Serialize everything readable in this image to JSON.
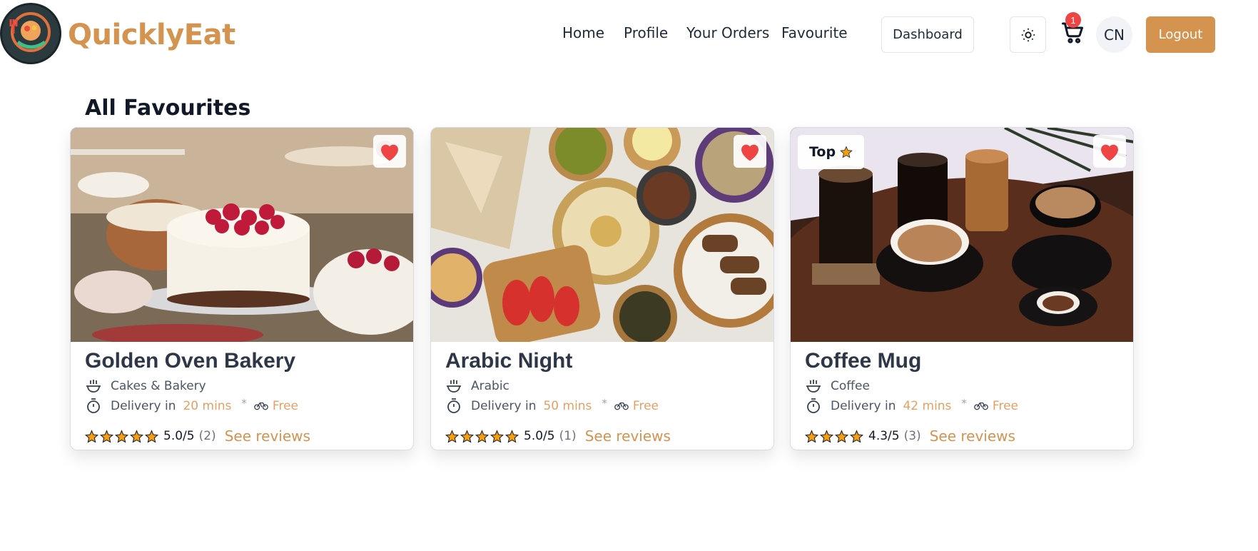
{
  "brand": {
    "name": "QuicklyEat"
  },
  "nav": {
    "home": "Home",
    "profile": "Profile",
    "orders": "Your Orders",
    "favourite": "Favourite",
    "dashboard": "Dashboard",
    "cart_count": "1",
    "avatar_initials": "CN",
    "logout": "Logout",
    "theme_icon": "sun-icon",
    "cart_icon": "cart-icon"
  },
  "page": {
    "title": "All Favourites"
  },
  "colors": {
    "accent": "#d4934e",
    "heart": "#ef4444",
    "star": "#f59e0b"
  },
  "cards": [
    {
      "name": "Golden Oven Bakery",
      "category": "Cakes & Bakery",
      "delivery_label": "Delivery in",
      "delivery_time": "20 mins",
      "separator": "*",
      "delivery_fee": "Free",
      "rating": "5.0/5",
      "rating_count": "(2)",
      "stars": 5,
      "reviews_label": "See reviews",
      "favourite": true,
      "image": "cakes-photo"
    },
    {
      "name": "Arabic Night",
      "category": "Arabic",
      "delivery_label": "Delivery in",
      "delivery_time": "50 mins",
      "separator": "*",
      "delivery_fee": "Free",
      "rating": "5.0/5",
      "rating_count": "(1)",
      "stars": 5,
      "reviews_label": "See reviews",
      "favourite": true,
      "image": "mezze-photo"
    },
    {
      "name": "Coffee Mug",
      "category": "Coffee",
      "delivery_label": "Delivery in",
      "delivery_time": "42 mins",
      "separator": "*",
      "delivery_fee": "Free",
      "rating": "4.3/5",
      "rating_count": "(3)",
      "stars": 4,
      "reviews_label": "See reviews",
      "favourite": true,
      "badge": "Top",
      "image": "coffee-photo"
    }
  ]
}
